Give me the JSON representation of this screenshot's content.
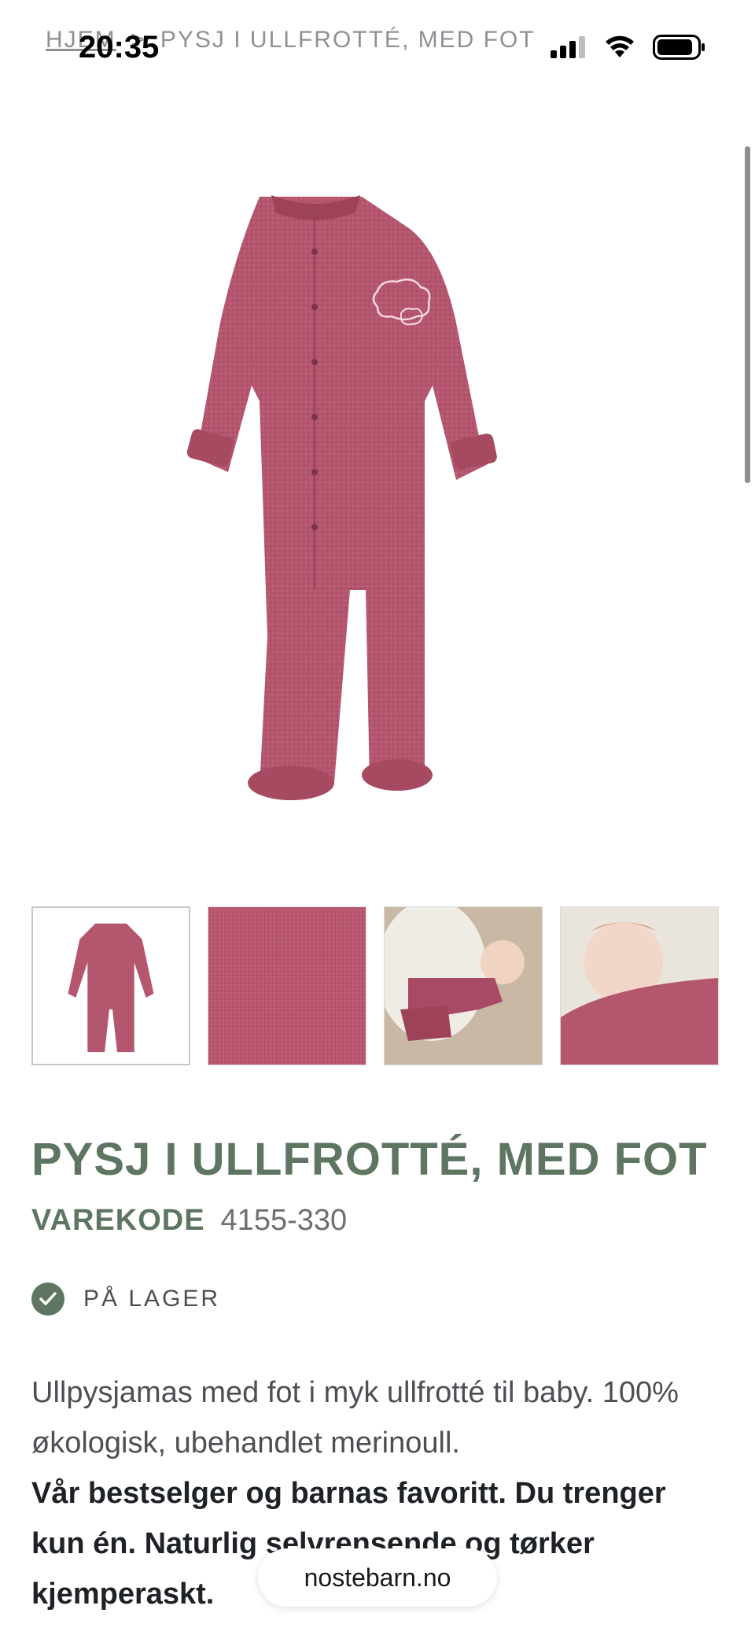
{
  "status_bar": {
    "time": "20:35"
  },
  "breadcrumb": {
    "home": "HJEM",
    "separator": ">",
    "current": "PYSJ I ULLFROTTÉ, MED FOT"
  },
  "product": {
    "title": "PYSJ I ULLFROTTÉ, MED FOT",
    "sku_label": "VAREKODE",
    "sku_value": "4155-330",
    "stock": "PÅ LAGER",
    "description_regular": "Ullpysjamas med fot i myk ullfrotté til baby. 100% økologisk, ubehandlet merinoull.",
    "description_bold": "Vår bestselger og barnas favoritt. Du trenger kun én. Naturlig selvrensende og tørker kjemperaskt."
  },
  "thumbnails": [
    {
      "name": "thumbnail-front-view"
    },
    {
      "name": "thumbnail-fabric-closeup"
    },
    {
      "name": "thumbnail-baby-lying"
    },
    {
      "name": "thumbnail-baby-closeup"
    }
  ],
  "browser": {
    "url": "nostebarn.no"
  },
  "colors": {
    "accent": "#5e7561",
    "garment": "#b5566f",
    "text": "#2b2f33"
  }
}
